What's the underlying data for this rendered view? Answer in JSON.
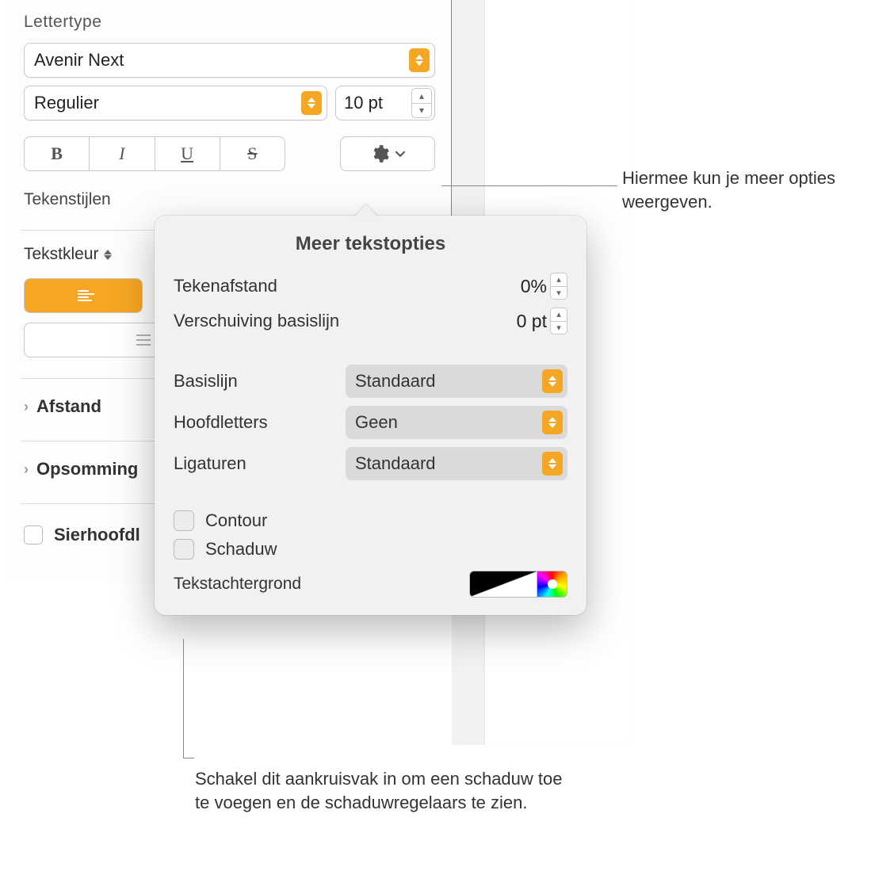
{
  "panel": {
    "heading": "Lettertype",
    "fontFamily": "Avenir Next",
    "fontStyle": "Regulier",
    "fontSize": "10 pt",
    "styleButtons": {
      "bold": "B",
      "italic": "I",
      "underline": "U",
      "strike": "S"
    },
    "characterStyles": "Tekenstijlen",
    "textColor": "Tekstkleur",
    "spacing": "Afstand",
    "bullets": "Opsomming",
    "dropCaps": "Sierhoofdl"
  },
  "popover": {
    "title": "Meer tekstopties",
    "characterSpacingLabel": "Tekenafstand",
    "characterSpacingValue": "0%",
    "baselineShiftLabel": "Verschuiving basislijn",
    "baselineShiftValue": "0 pt",
    "baselineLabel": "Basislijn",
    "baselineValue": "Standaard",
    "capsLabel": "Hoofdletters",
    "capsValue": "Geen",
    "ligaturesLabel": "Ligaturen",
    "ligaturesValue": "Standaard",
    "outlineLabel": "Contour",
    "shadowLabel": "Schaduw",
    "textBackgroundLabel": "Tekstachtergrond"
  },
  "callouts": {
    "moreOptions": "Hiermee kun je meer opties weergeven.",
    "shadowHint": "Schakel dit aankruisvak in om een schaduw toe te voegen en de schaduwregelaars te zien."
  }
}
